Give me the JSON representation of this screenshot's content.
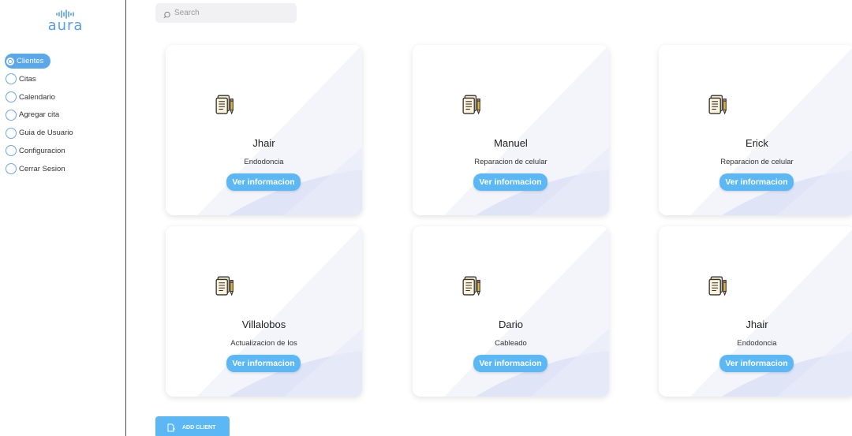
{
  "app": {
    "logo_text": "aura"
  },
  "sidebar": {
    "items": [
      {
        "label": "Clientes",
        "active": true
      },
      {
        "label": "Citas",
        "active": false
      },
      {
        "label": "Calendario",
        "active": false
      },
      {
        "label": "Agregar cita",
        "active": false
      },
      {
        "label": "Guia de Usuario",
        "active": false
      },
      {
        "label": "Configuracion",
        "active": false
      },
      {
        "label": "Cerrar Sesion",
        "active": false
      }
    ]
  },
  "search": {
    "placeholder": "Search",
    "value": ""
  },
  "cards": [
    {
      "name": "Jhair",
      "description": "Endodoncia",
      "button_label": "Ver informacion",
      "icon": "document-pen-icon"
    },
    {
      "name": "Manuel",
      "description": "Reparacion de celular",
      "button_label": "Ver informacion",
      "icon": "document-pen-icon"
    },
    {
      "name": "Erick",
      "description": "Reparacion de celular",
      "button_label": "Ver informacion",
      "icon": "document-pen-icon"
    },
    {
      "name": "Villalobos",
      "description": "Actualizacion de Ios",
      "button_label": "Ver informacion",
      "icon": "document-pen-icon"
    },
    {
      "name": "Dario",
      "description": "Cableado",
      "button_label": "Ver informacion",
      "icon": "document-pen-icon"
    },
    {
      "name": "Jhair",
      "description": "Endodoncia",
      "button_label": "Ver informacion",
      "icon": "document-pen-icon"
    }
  ],
  "add_client": {
    "label": "ADD CLIENT",
    "icon": "add-document-icon"
  },
  "colors": {
    "accent": "#5aa7ec",
    "button": "#5cb8f5",
    "card_wave": "#dfe4f7"
  }
}
